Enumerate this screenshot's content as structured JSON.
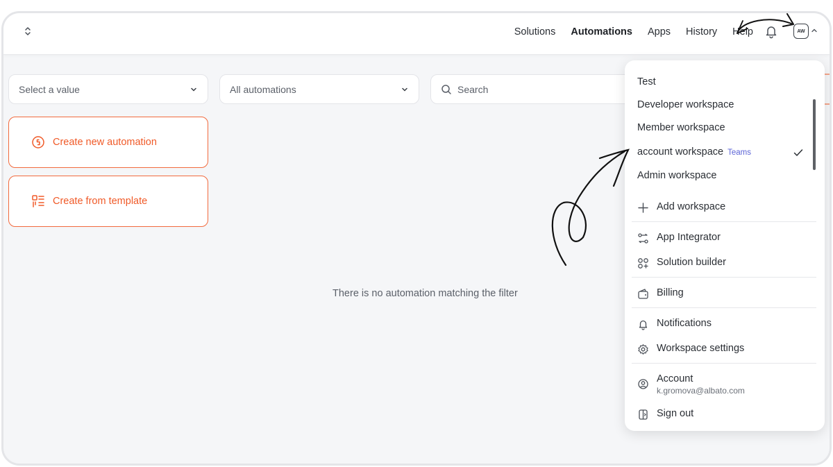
{
  "header": {
    "nav": [
      "Solutions",
      "Automations",
      "Apps",
      "History",
      "Help"
    ],
    "active_nav": "Automations",
    "avatar_initials": "AW"
  },
  "filters": {
    "select_placeholder": "Select a value",
    "automations_filter": "All automations",
    "search_placeholder": "Search"
  },
  "actions": {
    "create_new": "Create new automation",
    "create_template": "Create from template"
  },
  "empty_state": "There is no automation matching the filter",
  "dropdown": {
    "workspaces": [
      "Test",
      "Developer workspace",
      "Member workspace",
      "account workspace",
      "Admin workspace"
    ],
    "selected_workspace": "account workspace",
    "teams_badge": "Teams",
    "add_workspace": "Add workspace",
    "app_integrator": "App Integrator",
    "solution_builder": "Solution builder",
    "billing": "Billing",
    "notifications": "Notifications",
    "workspace_settings": "Workspace settings",
    "account": "Account",
    "account_email": "k.gromova@albato.com",
    "sign_out": "Sign out"
  },
  "colors": {
    "accent": "#f05a28",
    "badge": "#5b63d6"
  }
}
